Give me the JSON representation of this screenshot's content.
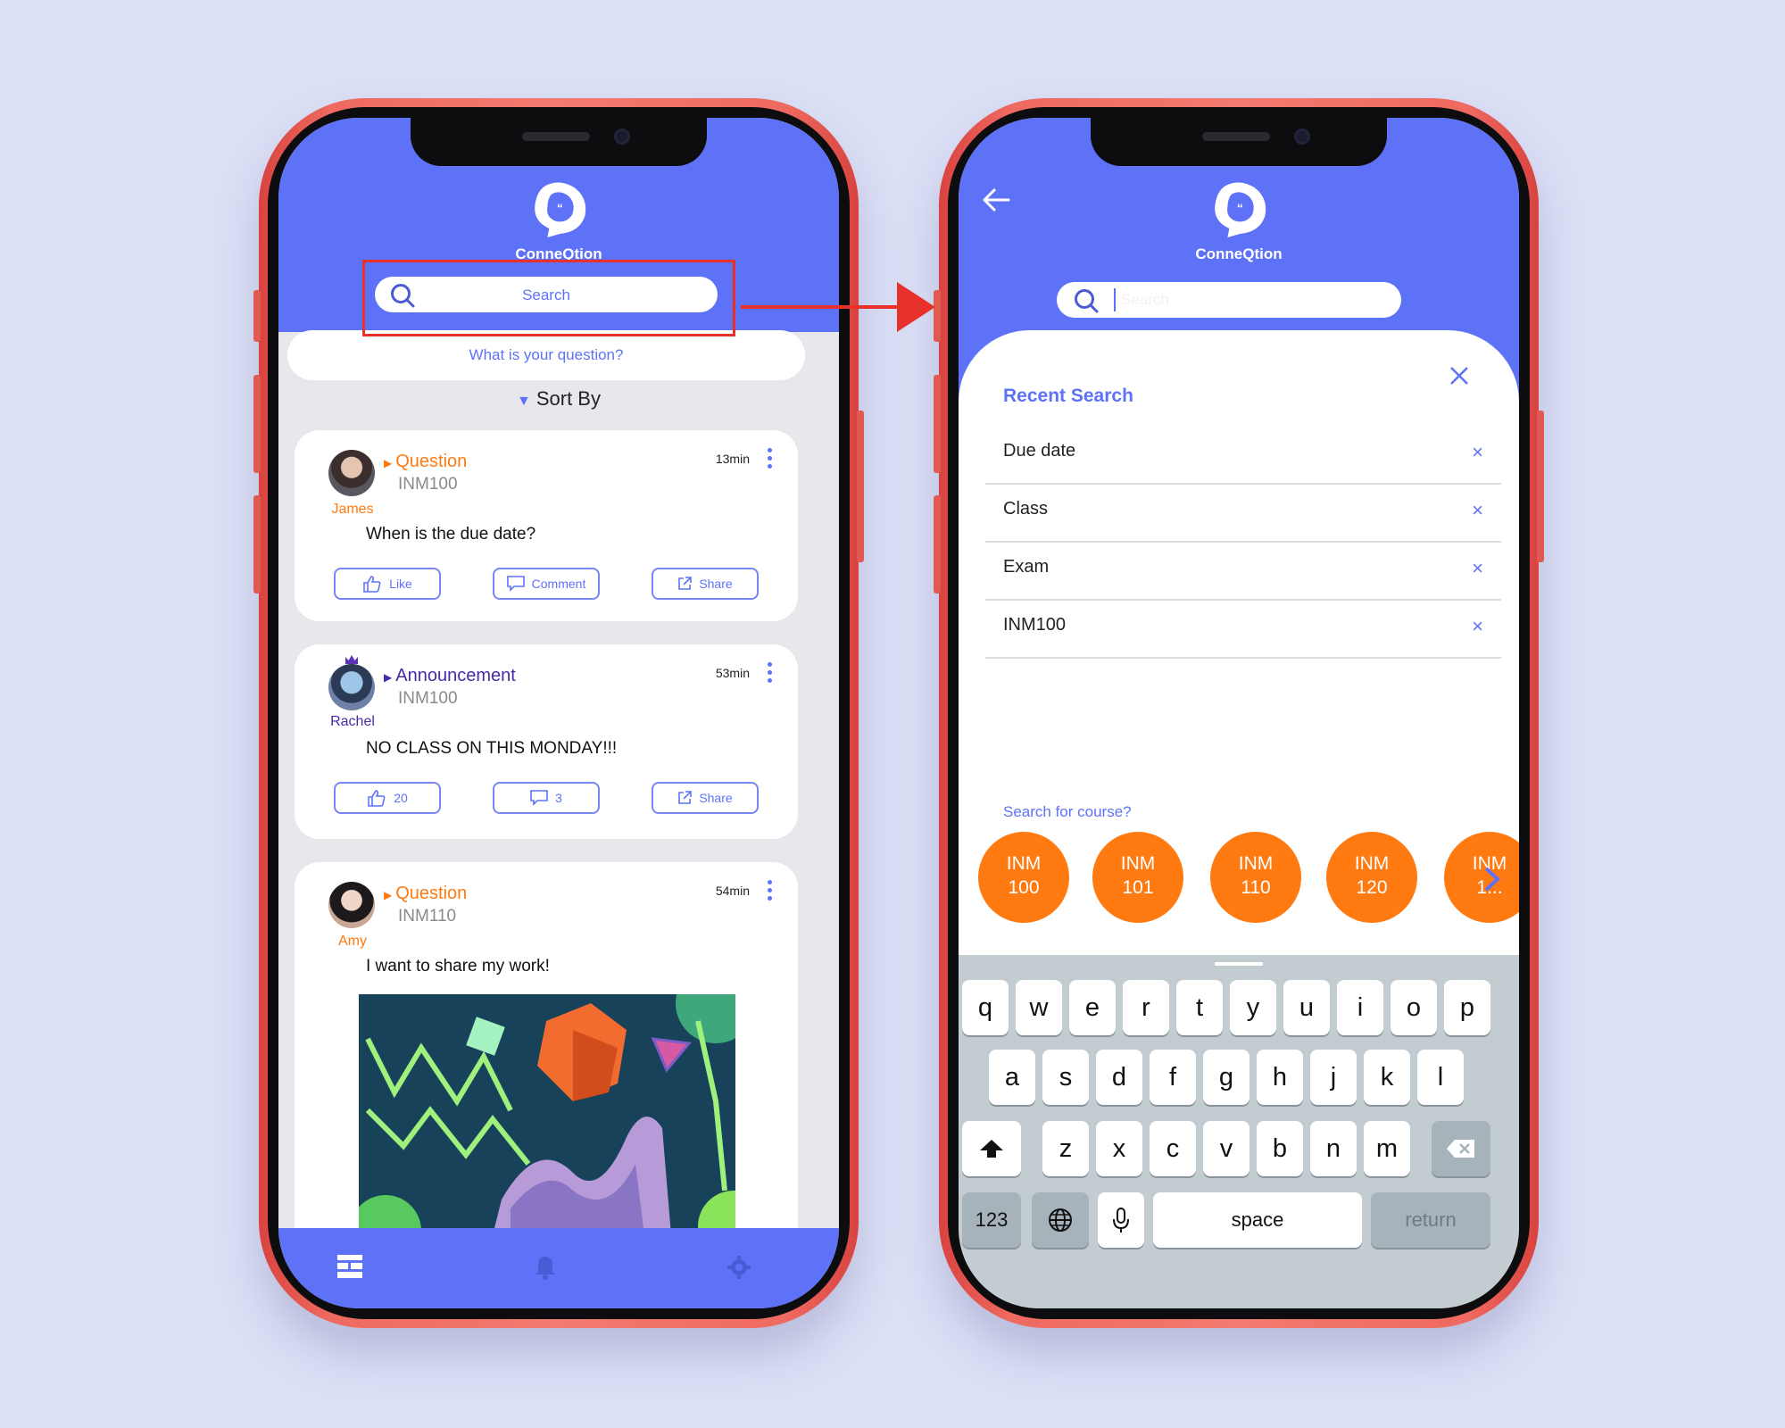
{
  "app": {
    "name": "ConneQtion"
  },
  "feed_screen": {
    "search": {
      "label": "Search"
    },
    "question_prompt": "What is your question?",
    "sort": {
      "label": "Sort By"
    },
    "posts": [
      {
        "author": "James",
        "type": "Question",
        "course": "INM100",
        "time": "13min",
        "text": "When is the due date?",
        "like_label": "Like",
        "comment_label": "Comment",
        "share_label": "Share"
      },
      {
        "author": "Rachel",
        "type": "Announcement",
        "course": "INM100",
        "time": "53min",
        "text": "NO CLASS ON THIS MONDAY!!!",
        "like_label": "20",
        "comment_label": "3",
        "share_label": "Share"
      },
      {
        "author": "Amy",
        "type": "Question",
        "course": "INM110",
        "time": "54min",
        "text": "I want to share my work!"
      }
    ],
    "bottom_nav": [
      "feed-icon",
      "bell-icon",
      "gear-icon"
    ]
  },
  "search_screen": {
    "search": {
      "placeholder": "Search",
      "value": ""
    },
    "recent_title": "Recent Search",
    "recent_items": [
      "Due date",
      "Class",
      "Exam",
      "INM100"
    ],
    "course_prompt": "Search for course?",
    "courses": [
      {
        "line1": "INM",
        "line2": "100"
      },
      {
        "line1": "INM",
        "line2": "101"
      },
      {
        "line1": "INM",
        "line2": "110"
      },
      {
        "line1": "INM",
        "line2": "120"
      },
      {
        "line1": "INM",
        "line2": "1..."
      }
    ],
    "keyboard": {
      "row1": [
        "q",
        "w",
        "e",
        "r",
        "t",
        "y",
        "u",
        "i",
        "o",
        "p"
      ],
      "row2": [
        "a",
        "s",
        "d",
        "f",
        "g",
        "h",
        "j",
        "k",
        "l"
      ],
      "row3": [
        "z",
        "x",
        "c",
        "v",
        "b",
        "n",
        "m"
      ],
      "numbers_key": "123",
      "space_key": "space",
      "return_key": "return"
    }
  },
  "colors": {
    "accent": "#5e72f8",
    "question": "#ff7a10",
    "announcement": "#4a2aa8",
    "highlight": "#e8312b",
    "phone": "#f27a70"
  }
}
